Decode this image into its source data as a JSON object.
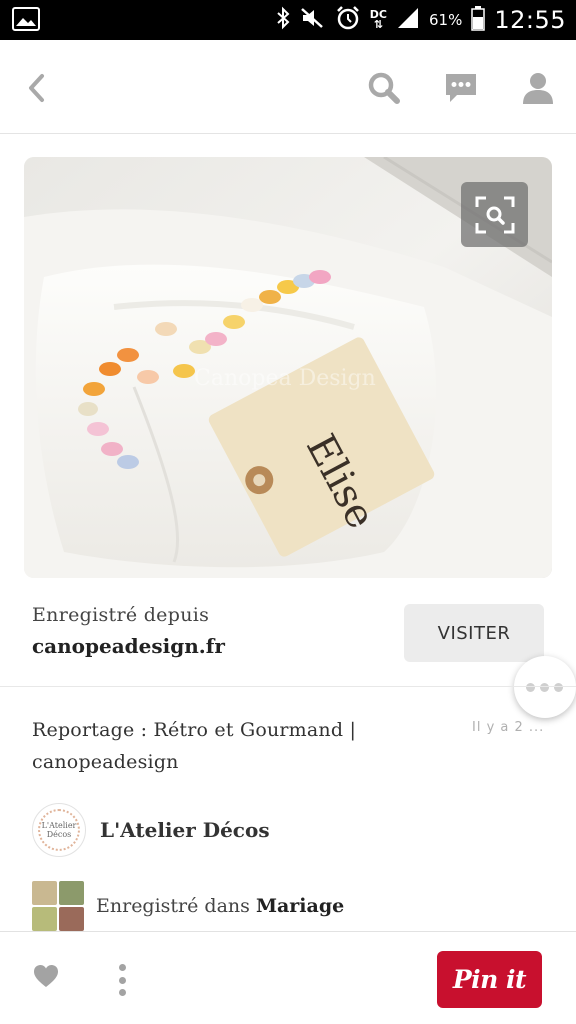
{
  "status_bar": {
    "battery": "61%",
    "time": "12:55",
    "network_label": "DC",
    "icons": [
      "gallery-icon",
      "bluetooth-icon",
      "mute-icon",
      "alarm-icon",
      "data-icon",
      "signal-icon",
      "battery-icon"
    ]
  },
  "app_bar": {
    "icons": [
      "back-icon",
      "search-icon",
      "messages-icon",
      "profile-icon"
    ]
  },
  "pin": {
    "tag_text": "Elise",
    "watermark": "Canopea Design"
  },
  "source": {
    "label": "Enregistré depuis",
    "domain": "canopeadesign.fr",
    "visit_label": "VISITER"
  },
  "description": {
    "text": "Reportage : Rétro et Gourmand | canopeadesign",
    "time_ago": "Il y a 2 ..."
  },
  "board": {
    "name": "L'Atelier Décos",
    "avatar_text": "L'Atelier Décos"
  },
  "saved_in": {
    "prefix": "Enregistré dans",
    "board": "Mariage"
  },
  "bottom_bar": {
    "pin_it_label": "Pin it"
  },
  "colors": {
    "accent_red": "#c8102e",
    "icon_gray": "#a9a9a9",
    "status_bar_bg": "#000000"
  }
}
